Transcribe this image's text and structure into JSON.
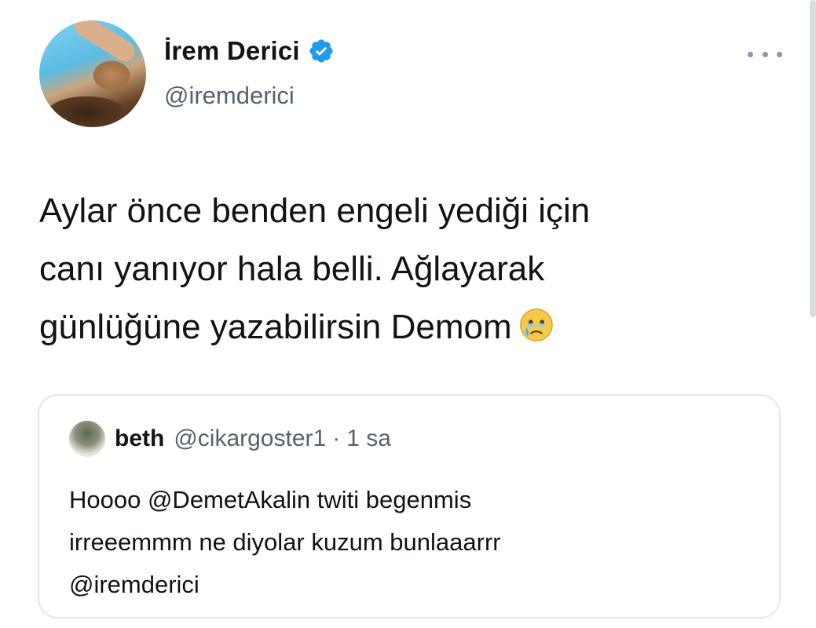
{
  "author": {
    "display_name": "İrem Derici",
    "handle": "@iremderici",
    "verified": true
  },
  "tweet": {
    "lines": [
      "Aylar önce benden engeli yediği için",
      "canı yanıyor hala belli. Ağlayarak",
      "günlüğüne yazabilirsin Demom"
    ],
    "emoji": "face-holding-back-tears-icon"
  },
  "quoted_tweet": {
    "display_name": "beth",
    "handle": "@cikargoster1",
    "separator": "·",
    "time": "1 sa",
    "lines": [
      "Hoooo @DemetAkalin twiti begenmis",
      "irreeemmm ne diyolar kuzum bunlaaarrr",
      "@iremderici"
    ]
  },
  "colors": {
    "text": "#0f1419",
    "secondary_text": "#536471",
    "verified_blue": "#1d9bf0",
    "border": "#e3e7ea"
  }
}
